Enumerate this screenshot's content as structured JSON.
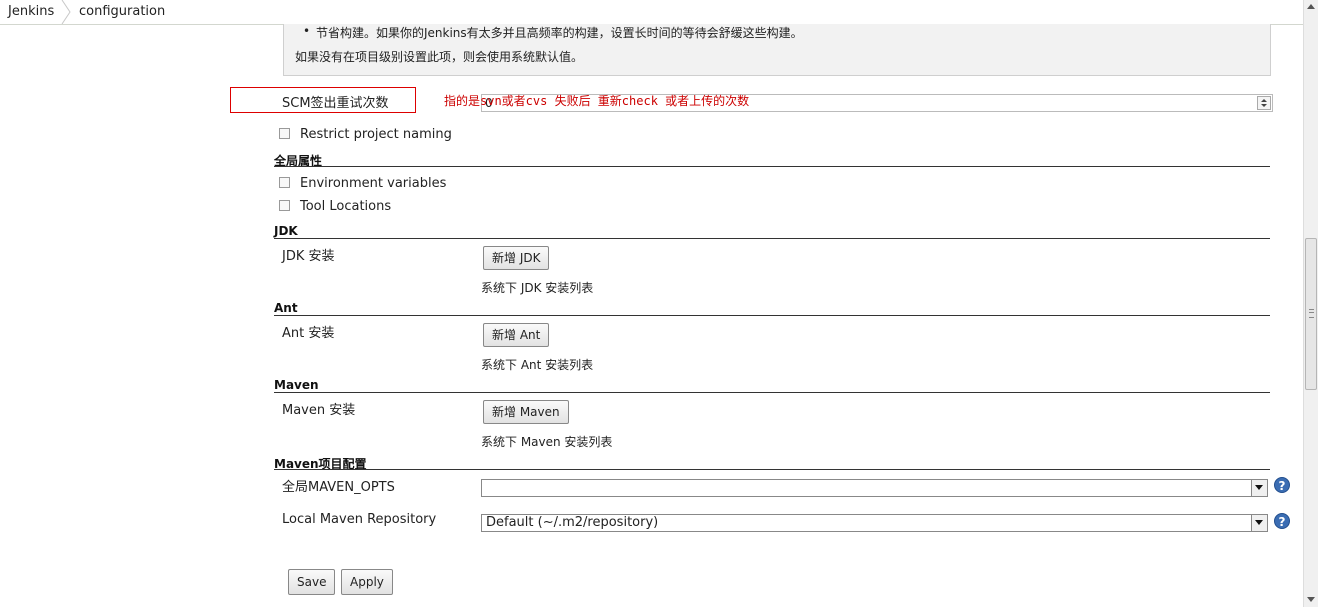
{
  "breadcrumb": {
    "items": [
      "Jenkins",
      "configuration"
    ]
  },
  "help_box": {
    "bullet": "节省构建。如果你的Jenkins有太多并且高频率的构建，设置长时间的等待会舒缓这些构建。",
    "note": "如果没有在项目级别设置此项，则会使用系统默认值。"
  },
  "scm": {
    "label": "SCM签出重试次数",
    "value": "0",
    "annotation": "指的是svn或者cvs 失败后 重新check 或者上传的次数"
  },
  "checkboxes": {
    "restrict_project_naming": "Restrict project naming",
    "environment_variables": "Environment variables",
    "tool_locations": "Tool Locations"
  },
  "sections": {
    "global_properties": "全局属性",
    "jdk": "JDK",
    "ant": "Ant",
    "maven": "Maven",
    "maven_project_config": "Maven项目配置"
  },
  "jdk": {
    "label": "JDK 安装",
    "button": "新增 JDK",
    "hint": "系统下 JDK 安装列表"
  },
  "ant": {
    "label": "Ant 安装",
    "button": "新增 Ant",
    "hint": "系统下 Ant 安装列表"
  },
  "maven": {
    "label": "Maven 安装",
    "button": "新增 Maven",
    "hint": "系统下 Maven 安装列表"
  },
  "maven_config": {
    "opts_label": "全局MAVEN_OPTS",
    "opts_value": "",
    "repo_label": "Local Maven Repository",
    "repo_value": "Default (~/.m2/repository)"
  },
  "actions": {
    "save": "Save",
    "apply": "Apply"
  },
  "icons": {
    "help": "?"
  },
  "colors": {
    "annotation": "#cc0000",
    "help_icon": "#3b6db3"
  }
}
